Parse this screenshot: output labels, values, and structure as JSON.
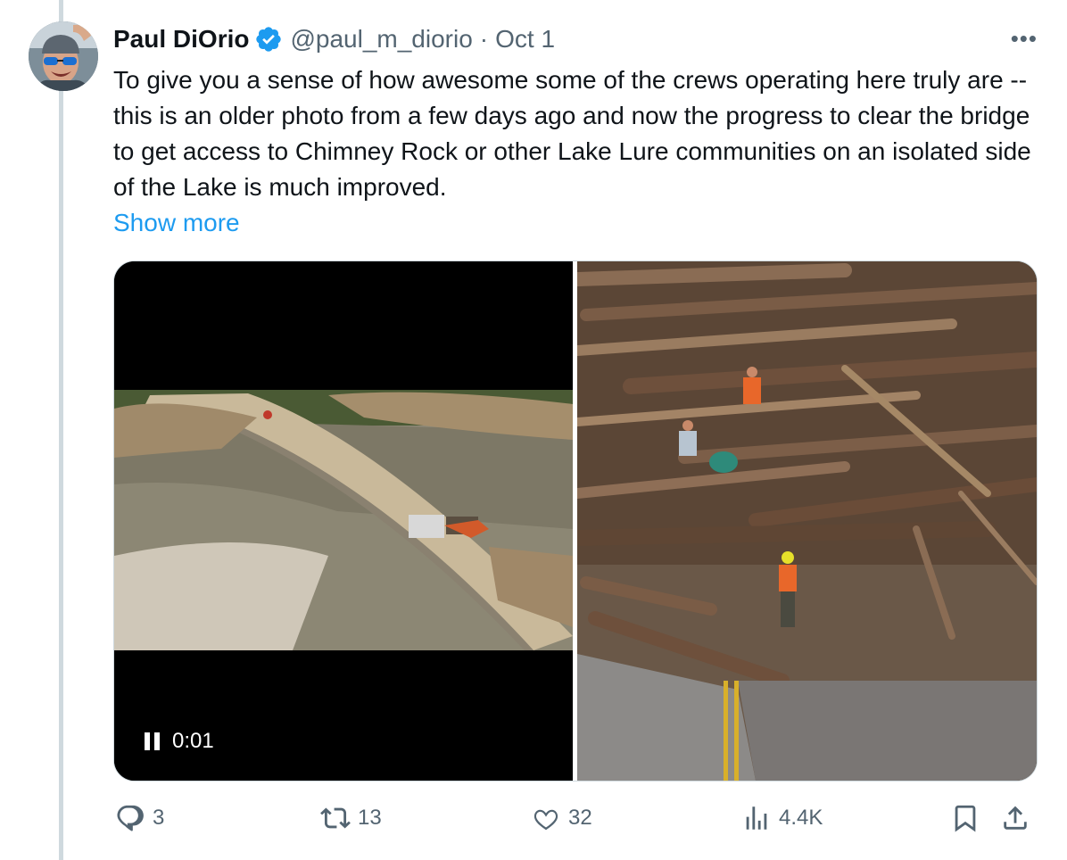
{
  "author": {
    "name": "Paul DiOrio",
    "handle": "@paul_m_diorio",
    "separator": "·",
    "date": "Oct 1"
  },
  "tweet": {
    "text": "To give you a sense of how awesome some of the crews operating here truly are -- this is an older photo from a few days ago and now the progress to clear the bridge to get access to Chimney Rock or other Lake Lure communities on an isolated side of the Lake is much improved.",
    "show_more_label": "Show more",
    "more_menu_label": "•••"
  },
  "media": {
    "video_time": "0:01",
    "video_state": "playing"
  },
  "actions": {
    "replies": "3",
    "reposts": "13",
    "likes": "32",
    "views": "4.4K"
  },
  "colors": {
    "accent": "#1d9bf0",
    "secondary_text": "#536471",
    "thread_line": "#cfd9de"
  }
}
